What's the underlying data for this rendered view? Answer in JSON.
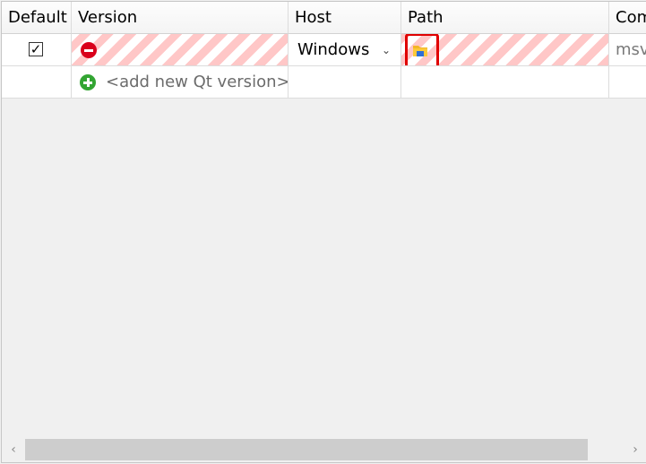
{
  "columns": {
    "default": "Default",
    "version": "Version",
    "host": "Host",
    "path": "Path",
    "compiler": "Com"
  },
  "rows": [
    {
      "default_checked": "✓",
      "status_icon": "remove-icon",
      "host": "Windows",
      "compiler": "msvc"
    }
  ],
  "add_row": {
    "label": "<add new Qt version>",
    "icon": "add-icon"
  },
  "highlight_color": "#e00000",
  "stripe_color": "#ffc7c7"
}
